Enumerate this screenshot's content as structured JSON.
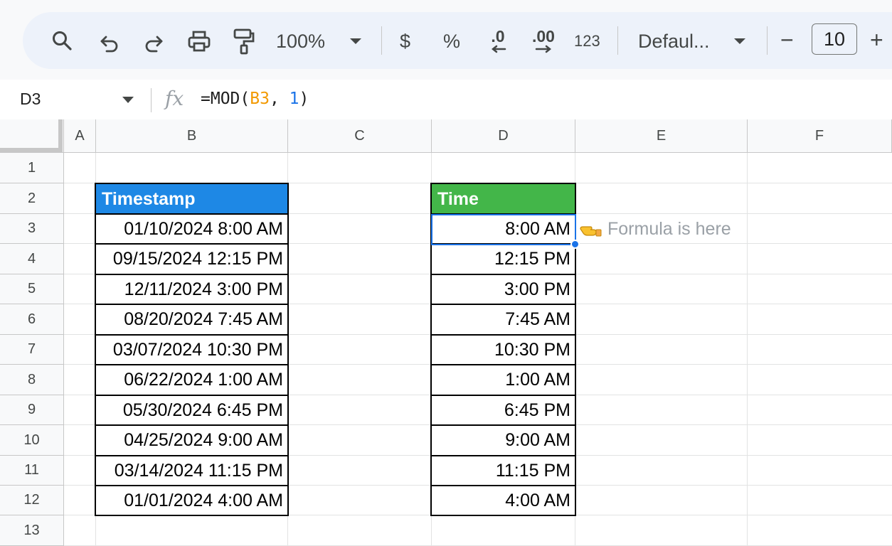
{
  "toolbar": {
    "zoom": "100%",
    "currency_symbol": "$",
    "percent_symbol": "%",
    "decrease_decimal": ".0",
    "increase_decimal": ".00",
    "number_format": "123",
    "font_name": "Defaul...",
    "font_size": "10",
    "minus": "−",
    "plus": "+"
  },
  "formula_bar": {
    "cell_ref": "D3",
    "fx": "fx",
    "formula_prefix": "=MOD(",
    "formula_ref": "B3",
    "formula_mid": ", ",
    "formula_num": "1",
    "formula_suffix": ")"
  },
  "columns": [
    "A",
    "B",
    "C",
    "D",
    "E",
    "F"
  ],
  "rows": [
    "1",
    "2",
    "3",
    "4",
    "5",
    "6",
    "7",
    "8",
    "9",
    "10",
    "11",
    "12",
    "13"
  ],
  "table_b": {
    "header": "Timestamp",
    "header_color": "#1e88e5",
    "values": [
      "01/10/2024 8:00 AM",
      "09/15/2024 12:15 PM",
      "12/11/2024 3:00 PM",
      "08/20/2024 7:45 AM",
      "03/07/2024 10:30 PM",
      "06/22/2024 1:00 AM",
      "05/30/2024 6:45 PM",
      "04/25/2024 9:00 AM",
      "03/14/2024 11:15 PM",
      "01/01/2024 4:00 AM"
    ]
  },
  "table_d": {
    "header": "Time",
    "header_color": "#43b649",
    "values": [
      "8:00 AM",
      "12:15 PM",
      "3:00 PM",
      "7:45 AM",
      "10:30 PM",
      "1:00 AM",
      "6:45 PM",
      "9:00 AM",
      "11:15 PM",
      "4:00 AM"
    ]
  },
  "note": "Formula is here",
  "selection_color": "#1a73e8"
}
